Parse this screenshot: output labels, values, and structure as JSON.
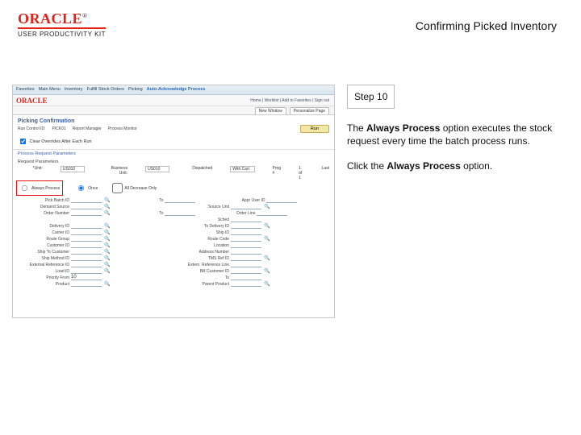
{
  "header": {
    "brand": "ORACLE",
    "brand_tm": "®",
    "brand_sub": "USER PRODUCTIVITY KIT",
    "title": "Confirming Picked Inventory"
  },
  "instructions": {
    "step_label": "Step 10",
    "body_pre": "The ",
    "body_bold": "Always Process",
    "body_post": " option executes the stock request every time the batch process runs.",
    "action_pre": "Click the ",
    "action_bold": "Always Process",
    "action_post": " option."
  },
  "app": {
    "menu": [
      "Favorites",
      "Main Menu",
      "Inventory",
      "Fulfill Stock Orders",
      "Picking",
      "Auto-Acknowledge Process"
    ],
    "logo": "ORACLE",
    "crumbs": "Home | Worklist | Add to Favorites | Sign out",
    "tabs": [
      "New Window",
      "Personalize Page"
    ],
    "page_title": "Picking Confirmation",
    "run_lbl_a": "Run Control ID:",
    "run_val_a": "PICK01",
    "run_lbl_b": "Report Manager",
    "run_lbl_c": "Process Monitor",
    "run_btn": "Run",
    "check_label": "Clear Overrides After Each Run",
    "section_a": "Process Request Parameters",
    "section_b": "Request Parameters",
    "proc_unit_lbl": "*Unit:",
    "proc_unit_val": "US010",
    "proc_bu_lbl": "Business Unit:",
    "proc_bu_val": "US010",
    "proc_dispatch_lbl": "Dispatched",
    "proc_dispatch_val": "With Cart",
    "proc_prog_lbl": "Prog #",
    "proc_prog_val": "1 of 1",
    "proc_last": "Last",
    "always_process": "Always Process",
    "once_label": "Once",
    "all_decr_label": "All Decrease Only",
    "fields_left": [
      "Pick Batch ID",
      "Demand Source",
      "Order Number",
      "Delivery ID",
      "Carrier ID",
      "Route Group",
      "Customer ID",
      "Ship To Customer",
      "Ship Method ID",
      "External Reference ID",
      "Load ID",
      "Priority From",
      "Product"
    ],
    "fields_right": [
      "Appr User ID",
      "Source Unit",
      "Order Line",
      "Sched",
      "To Delivery ID",
      "Ship ID",
      "Route Code",
      "Location",
      "Address Number",
      "TMS Ref ID",
      "Extern. Reference Line",
      "Bill Customer ID",
      "To",
      "Parent Product"
    ],
    "from_lbl": "From",
    "to_lbl": "To",
    "to_val": "10"
  }
}
